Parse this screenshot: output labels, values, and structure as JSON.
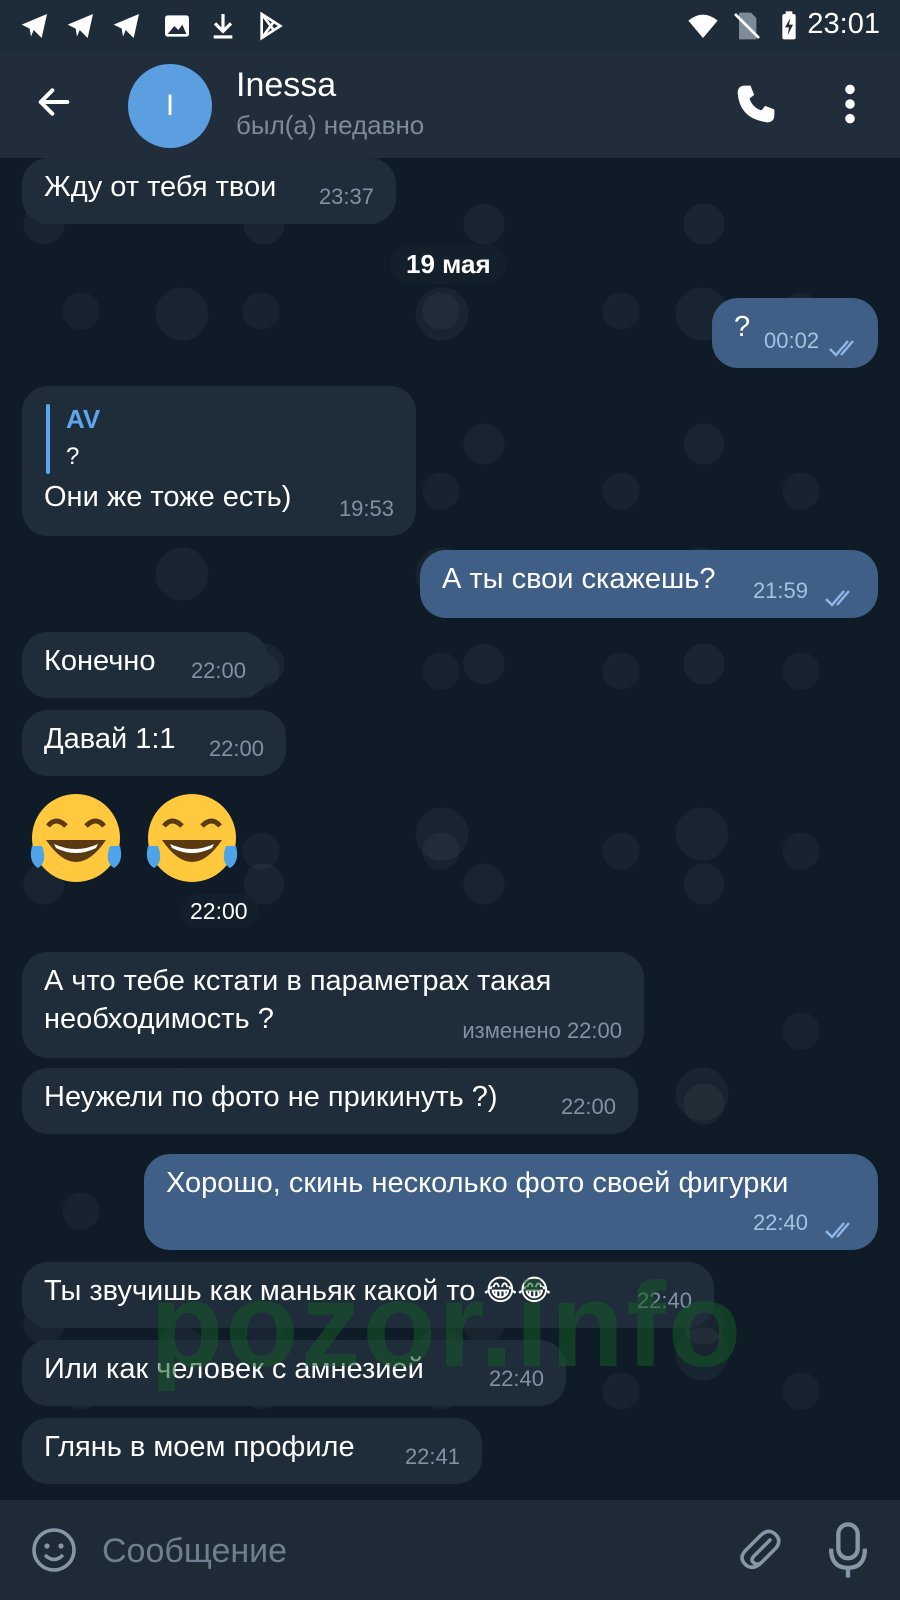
{
  "status_bar": {
    "time": "23:01"
  },
  "header": {
    "avatar_letter": "I",
    "name": "Inessa",
    "status": "был(а) недавно"
  },
  "chat": {
    "date_separator": "19 мая",
    "messages": [
      {
        "text": "Жду от тебя твои",
        "time": "23:37"
      },
      {
        "text": "?",
        "time": "00:02"
      },
      {
        "reply_author": "AV",
        "reply_text": "?",
        "text": "Они же тоже есть)",
        "time": "19:53"
      },
      {
        "text": "А ты свои скажешь?",
        "time": "21:59"
      },
      {
        "text": "Конечно",
        "time": "22:00"
      },
      {
        "text": "Давай 1:1",
        "time": "22:00"
      },
      {
        "emoji": "😂😂",
        "time": "22:00"
      },
      {
        "text_line1": "А что тебе  кстати в параметрах такая",
        "text_line2": "необходимость ?",
        "time": "изменено 22:00"
      },
      {
        "text": "Неужели по фото не прикинуть ?)",
        "time": "22:00"
      },
      {
        "text": "Хорошо, скинь несколько фото своей фигурки",
        "time": "22:40"
      },
      {
        "text": "Ты звучишь как маньяк какой то 😂😂",
        "time": "22:40"
      },
      {
        "text": "Или как человек с амнезией",
        "time": "22:40"
      },
      {
        "text": "Глянь в моем профиле",
        "time": "22:41"
      }
    ],
    "watermark": "pozor.info"
  },
  "input": {
    "placeholder": "Сообщение"
  }
}
